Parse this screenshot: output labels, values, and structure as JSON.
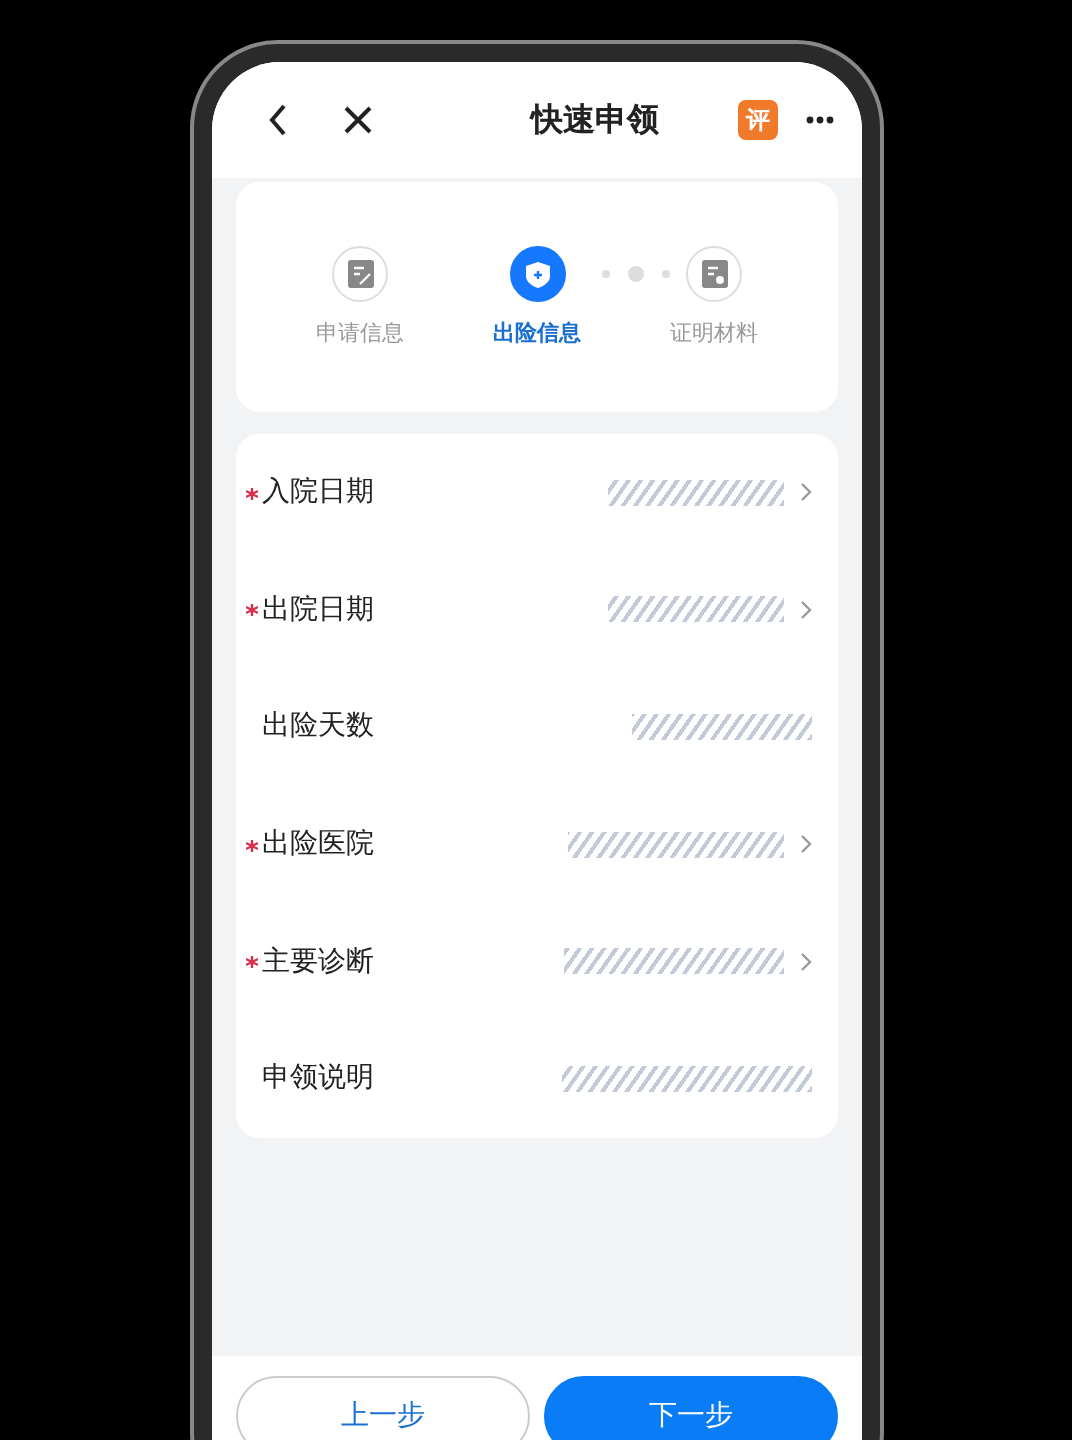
{
  "header": {
    "title": "快速申领",
    "badge": "评"
  },
  "steps": [
    {
      "label": "申请信息",
      "kind": "form",
      "selected": false
    },
    {
      "label": "出险信息",
      "kind": "shield",
      "selected": true
    },
    {
      "label": "证明材料",
      "kind": "document",
      "selected": false
    }
  ],
  "fields": [
    {
      "label": "入院日期",
      "required": true,
      "arrow": true
    },
    {
      "label": "出院日期",
      "required": true,
      "arrow": true
    },
    {
      "label": "出险天数",
      "required": false,
      "arrow": false
    },
    {
      "label": "出险医院",
      "required": true,
      "arrow": true
    },
    {
      "label": "主要诊断",
      "required": true,
      "arrow": true
    },
    {
      "label": "申领说明",
      "required": false,
      "arrow": false
    }
  ],
  "buttons": [
    {
      "label": "上一步",
      "kind": "secondary"
    },
    {
      "label": "下一步",
      "kind": "primary"
    }
  ]
}
